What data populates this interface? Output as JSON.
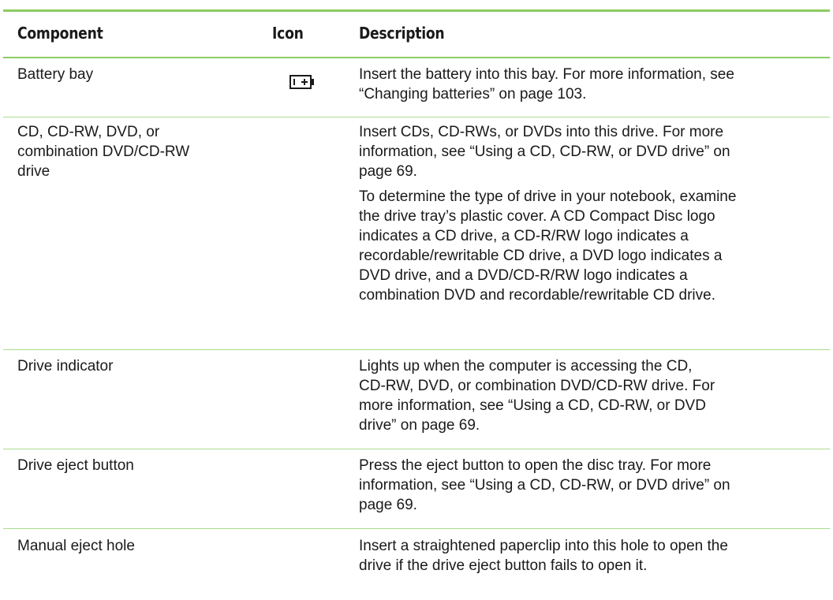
{
  "table": {
    "headers": {
      "component": "Component",
      "icon": "Icon",
      "description": "Description"
    },
    "rows": [
      {
        "component": "Battery bay",
        "icon": "battery-icon",
        "description": [
          [
            "Insert the battery into this bay. For more information, see",
            "“Changing batteries” on page 103."
          ]
        ]
      },
      {
        "component": "CD, CD-RW, DVD, or\ncombination DVD/CD-RW\ndrive",
        "icon": "",
        "description": [
          [
            "Insert CDs, CD-RWs, or DVDs into this drive. For more",
            "information, see “Using a CD, CD-RW, or DVD drive” on",
            "page 69."
          ],
          [
            "To determine the type of drive in your notebook, examine",
            "the drive tray’s plastic cover. A CD Compact Disc logo",
            "indicates a CD drive, a CD-R/RW logo indicates a",
            "recordable/rewritable CD drive, a DVD logo indicates a",
            "DVD drive, and a DVD/CD-R/RW logo indicates a",
            "combination DVD and recordable/rewritable CD drive."
          ]
        ]
      },
      {
        "component": "Drive indicator",
        "icon": "",
        "description": [
          [
            "Lights up when the computer is accessing the CD,",
            "CD-RW, DVD, or combination DVD/CD-RW drive. For",
            "more information, see “Using a CD, CD-RW, or DVD",
            "drive” on page 69."
          ]
        ]
      },
      {
        "component": "Drive eject button",
        "icon": "",
        "description": [
          [
            "Press the eject button to open the disc tray. For more",
            "information, see “Using a CD, CD-RW, or DVD drive” on",
            "page 69."
          ]
        ]
      },
      {
        "component": "Manual eject hole",
        "icon": "",
        "description": [
          [
            "Insert a straightened paperclip into this hole to open the",
            "drive if the drive eject button fails to open it."
          ]
        ]
      }
    ]
  },
  "colors": {
    "rule": "#8ccc63",
    "row_separator": "#a9dc8c",
    "text": "#1a1a1a"
  }
}
